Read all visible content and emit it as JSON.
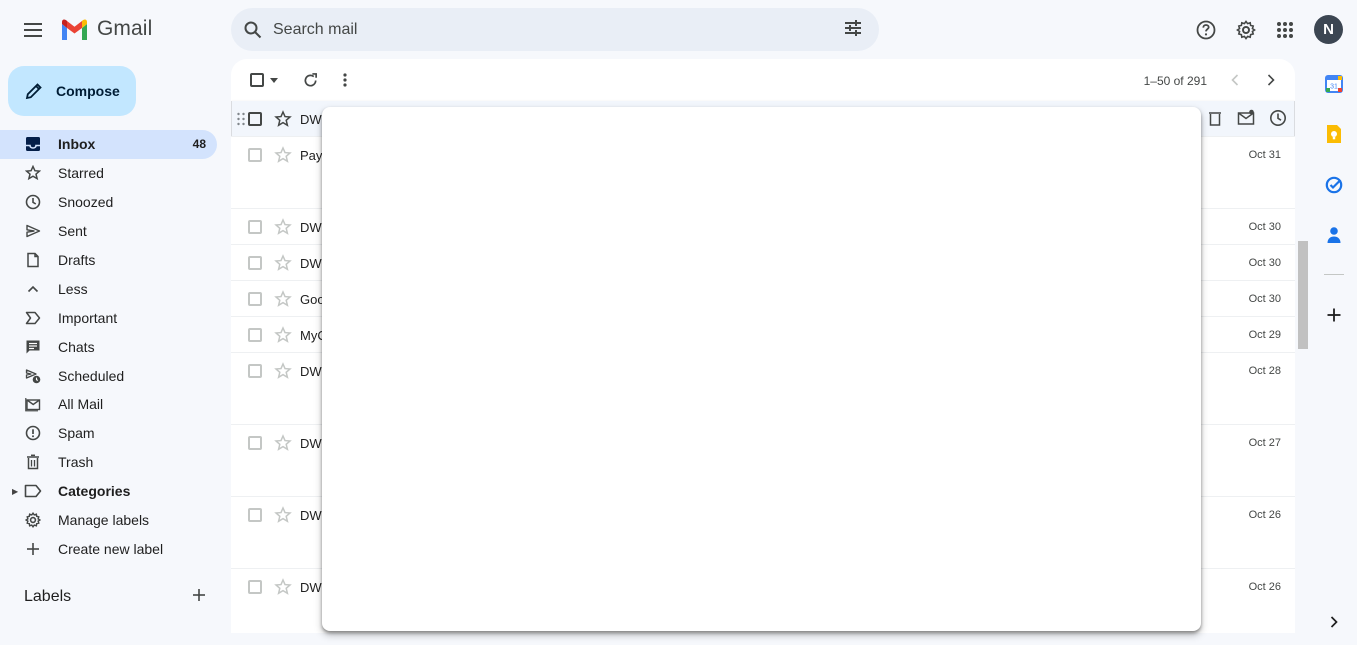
{
  "app": {
    "name": "Gmail"
  },
  "search": {
    "placeholder": "Search mail"
  },
  "account": {
    "initial": "N"
  },
  "compose": {
    "label": "Compose"
  },
  "nav": {
    "items": [
      {
        "label": "Inbox",
        "count": "48",
        "icon": "inbox-icon"
      },
      {
        "label": "Starred",
        "icon": "star-icon"
      },
      {
        "label": "Snoozed",
        "icon": "clock-icon"
      },
      {
        "label": "Sent",
        "icon": "send-icon"
      },
      {
        "label": "Drafts",
        "icon": "draft-icon"
      },
      {
        "label": "Less",
        "icon": "chevron-up-icon"
      },
      {
        "label": "Important",
        "icon": "important-icon"
      },
      {
        "label": "Chats",
        "icon": "chat-icon"
      },
      {
        "label": "Scheduled",
        "icon": "scheduled-icon"
      },
      {
        "label": "All Mail",
        "icon": "all-mail-icon"
      },
      {
        "label": "Spam",
        "icon": "spam-icon"
      },
      {
        "label": "Trash",
        "icon": "trash-icon"
      },
      {
        "label": "Categories",
        "icon": "label-icon"
      },
      {
        "label": "Manage labels",
        "icon": "gear-icon"
      },
      {
        "label": "Create new label",
        "icon": "plus-icon"
      }
    ]
  },
  "labels": {
    "heading": "Labels"
  },
  "toolbar": {
    "pager": "1–50 of 291"
  },
  "emails": [
    {
      "sender": "DWS",
      "date": ""
    },
    {
      "sender": "Payt",
      "date": "Oct 31"
    },
    {
      "sender": "DWS",
      "date": "Oct 30"
    },
    {
      "sender": "DWS",
      "date": "Oct 30"
    },
    {
      "sender": "Goo",
      "date": "Oct 30"
    },
    {
      "sender": "MyC",
      "date": "Oct 29"
    },
    {
      "sender": "DWS",
      "date": "Oct 28"
    },
    {
      "sender": "DWS",
      "date": "Oct 27"
    },
    {
      "sender": "DWS",
      "date": "Oct 26"
    },
    {
      "sender": "DWS",
      "date": "Oct 26"
    }
  ],
  "colors": {
    "compose_bg": "#c2e7ff",
    "active_nav": "#d3e3fd",
    "background": "#f6f8fc",
    "avatar": "#3c4652"
  }
}
